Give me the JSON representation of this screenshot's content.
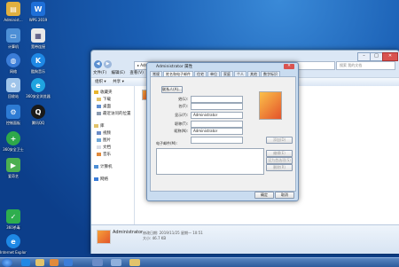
{
  "desktop": {
    "icons": [
      {
        "label": "Administ...",
        "icon": "user-folder-icon",
        "color": "#e0b040"
      },
      {
        "label": "WPS 2019",
        "icon": "wps-office-icon",
        "color": "#1e6fd8"
      },
      {
        "label": "计算机",
        "icon": "computer-icon",
        "color": "#4d8fd6"
      },
      {
        "label": "宽带连接",
        "icon": "broadband-icon",
        "color": "#e8e8e8"
      },
      {
        "label": "网络",
        "icon": "network-icon",
        "color": "#3b7dd8"
      },
      {
        "label": "酷狗音乐",
        "icon": "kugou-icon",
        "color": "#1e88e5"
      },
      {
        "label": "回收站",
        "icon": "recycle-bin-icon",
        "color": "#9fc4ea"
      },
      {
        "label": "360安全浏览器",
        "icon": "browser-icon",
        "color": "#1fa4e0"
      },
      {
        "label": "控制面板",
        "icon": "control-panel-icon",
        "color": "#2d7bd4"
      },
      {
        "label": "腾讯QQ",
        "icon": "qq-icon",
        "color": "#1a1a1a"
      },
      {
        "label": "360安全卫士",
        "icon": "security-guard-icon",
        "color": "#2ea84a"
      },
      {
        "label": "爱奇艺",
        "icon": "iqiyi-icon",
        "color": "#4caf50"
      },
      {
        "label": "360杀毒",
        "icon": "antivirus-icon",
        "color": "#2eae4e"
      },
      {
        "label": "Internet Explorer",
        "icon": "ie-icon",
        "color": "#1e88e5"
      }
    ]
  },
  "explorer": {
    "address": "▸ Administrator ▸ 我的文档 ▸",
    "search_placeholder": "搜索 我的文档",
    "menus": [
      "文件(F)",
      "编辑(E)",
      "查看(V)",
      "工具(T)",
      "帮助(H)"
    ],
    "cmd": [
      "组织 ▾",
      "共享 ▾"
    ],
    "nav": [
      {
        "label": "收藏夹",
        "icon": "star-icon",
        "color": "#e8b52c"
      },
      {
        "label": "下载",
        "icon": "download-folder-icon",
        "color": "#e2c36a"
      },
      {
        "label": "桌面",
        "icon": "desktop-folder-icon",
        "color": "#5f8fd2"
      },
      {
        "label": "最近访问的位置",
        "icon": "recent-places-icon",
        "color": "#8b9bb0"
      },
      {
        "label": "库",
        "icon": "libraries-icon",
        "color": "#e2c36a"
      },
      {
        "label": "视频",
        "icon": "videos-icon",
        "color": "#6b8cc7"
      },
      {
        "label": "图片",
        "icon": "pictures-icon",
        "color": "#6fa8d8"
      },
      {
        "label": "文档",
        "icon": "documents-icon",
        "color": "#d8dce6"
      },
      {
        "label": "音乐",
        "icon": "music-icon",
        "color": "#e08a3c"
      },
      {
        "label": "计算机",
        "icon": "computer-icon",
        "color": "#4d8fd6"
      },
      {
        "label": "网络",
        "icon": "network-icon",
        "color": "#3b7dd8"
      }
    ],
    "details": {
      "name": "Administrator",
      "line1": "修改日期: 2019/11/25 星期一 10:51",
      "line2": "大小: 46.7 KB"
    }
  },
  "dialog": {
    "title": "Administrator 属性",
    "tabs": [
      "常规",
      "姓名和电子邮件",
      "住宅",
      "单位",
      "家庭",
      "个人",
      "其他",
      "数字标识"
    ],
    "active_tab": 1,
    "contacts_btn": "联系人(A)...",
    "labels": {
      "first": "姓(L):",
      "display": "显示(Y):",
      "nickname": "昵称(N):",
      "given": "名(F):",
      "title": "职称(T):",
      "email": "电子邮件(M):"
    },
    "values": {
      "display": "Administrator",
      "nickname": "Administrator"
    },
    "right_buttons": [
      "添加(D)",
      "编辑(E)",
      "设为首选项(S)",
      "删除(R)"
    ],
    "ok": "确定",
    "cancel": "取消"
  }
}
